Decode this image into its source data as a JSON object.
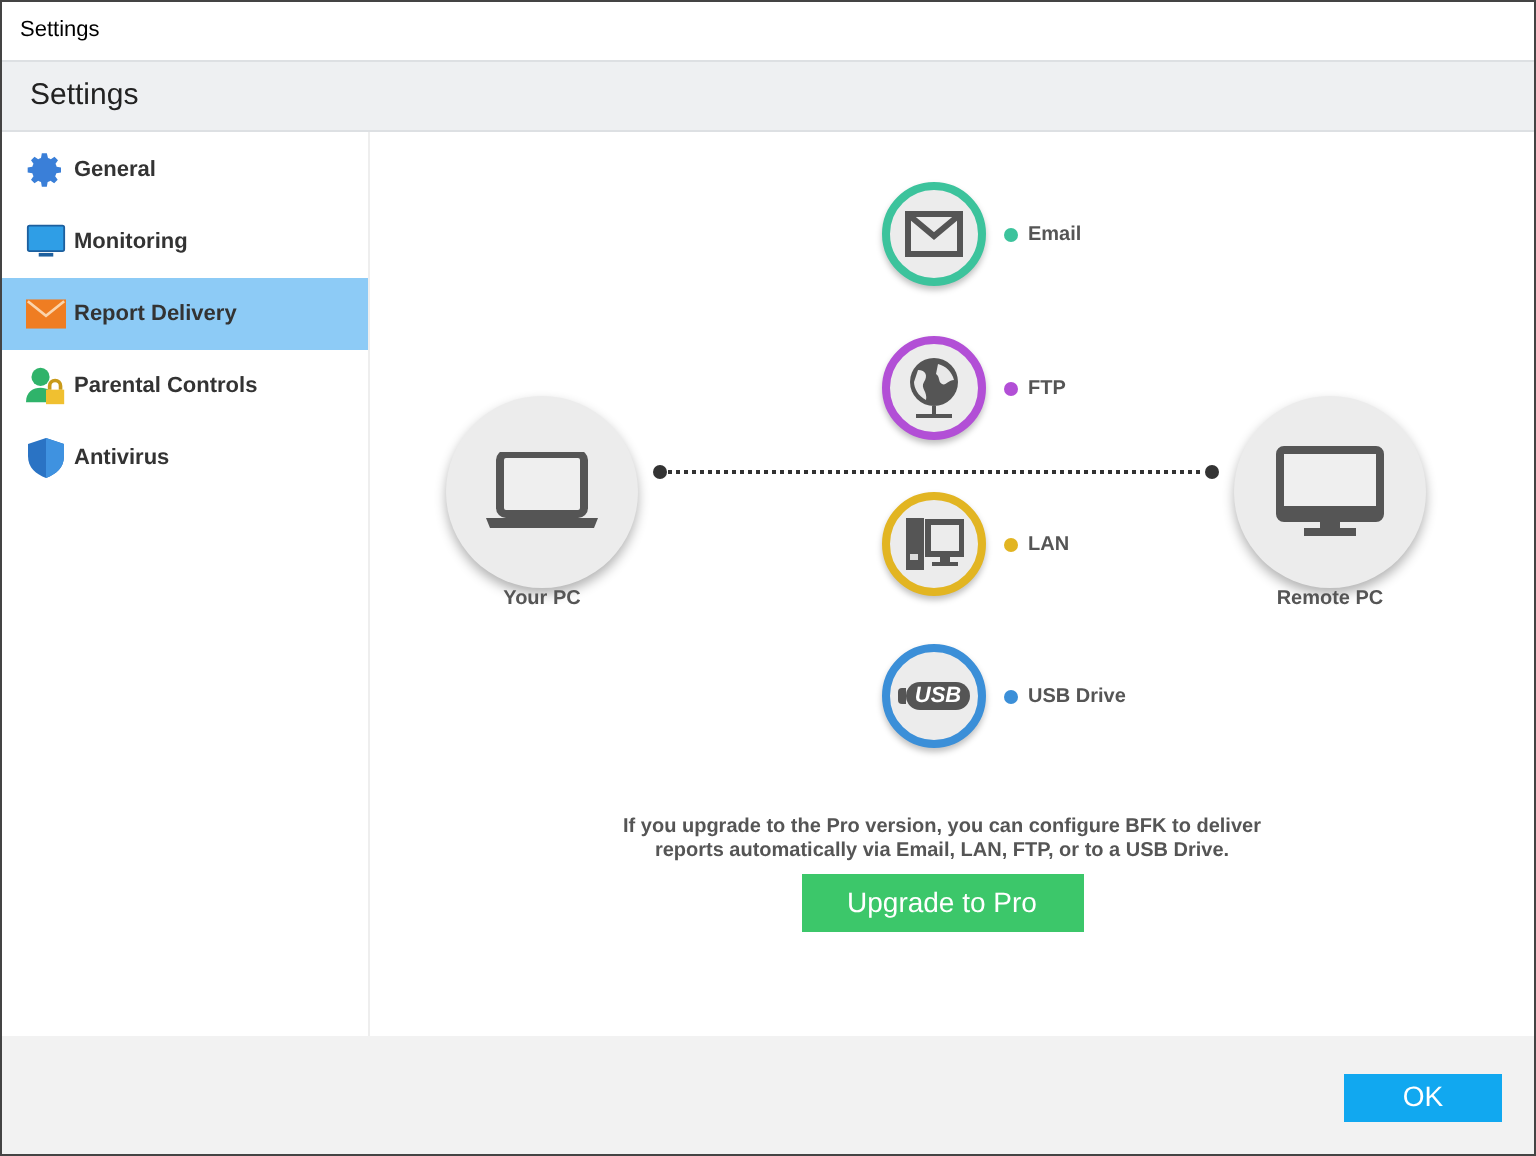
{
  "window": {
    "title": "Settings"
  },
  "header": {
    "title": "Settings"
  },
  "sidebar": {
    "items": [
      {
        "label": "General",
        "kind": "gear",
        "selected": false
      },
      {
        "label": "Monitoring",
        "kind": "monitor",
        "selected": false
      },
      {
        "label": "Report Delivery",
        "kind": "envelope",
        "selected": true
      },
      {
        "label": "Parental Controls",
        "kind": "person-lock",
        "selected": false
      },
      {
        "label": "Antivirus",
        "kind": "shield",
        "selected": false
      }
    ]
  },
  "diagram": {
    "source": {
      "label": "Your PC"
    },
    "target": {
      "label": "Remote PC"
    },
    "methods": [
      {
        "label": "Email",
        "kind": "email",
        "color": "#3cc39c"
      },
      {
        "label": "FTP",
        "kind": "ftp",
        "color": "#b24fd6"
      },
      {
        "label": "LAN",
        "kind": "lan",
        "color": "#e2b522"
      },
      {
        "label": "USB Drive",
        "kind": "usb",
        "color": "#3b8fd8",
        "badge": "USB"
      }
    ]
  },
  "message": "If you upgrade to the Pro version, you can configure BFK to deliver reports automatically via Email, LAN, FTP, or to a USB Drive.",
  "upgrade_button": "Upgrade to Pro",
  "ok_button": "OK"
}
